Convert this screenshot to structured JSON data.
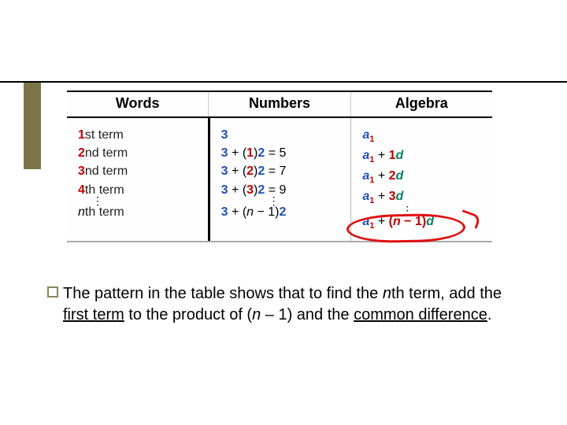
{
  "headers": {
    "c1": "Words",
    "c2": "Numbers",
    "c3": "Algebra"
  },
  "words": {
    "r1_num": "1",
    "r1_suffix": "st term",
    "r2_num": "2",
    "r2_suffix": "nd term",
    "r3_num": "3",
    "r3_suffix": "nd term",
    "r4_num": "4",
    "r4_suffix": "th term",
    "rn_var": "n",
    "rn_suffix": "th term"
  },
  "numbers": {
    "r1": "3",
    "r2_a": "3",
    "r2_b": " + (",
    "r2_c": "1",
    "r2_d": ")",
    "r2_e": "2",
    "r2_f": " = 5",
    "r3_a": "3",
    "r3_b": " + (",
    "r3_c": "2",
    "r3_d": ")",
    "r3_e": "2",
    "r3_f": " = 7",
    "r4_a": "3",
    "r4_b": " + (",
    "r4_c": "3",
    "r4_d": ")",
    "r4_e": "2",
    "r4_f": " = 9",
    "rn_a": "3",
    "rn_b": " + (",
    "rn_c": "n",
    "rn_d": " − 1)",
    "rn_e": "2"
  },
  "algebra": {
    "a": "a",
    "sub": "1",
    "plus": " + ",
    "c2": "1",
    "c3": "2",
    "c4": "3",
    "d": "d",
    "lpar": "(",
    "rpar": ")",
    "n": "n",
    "minus1": " − 1"
  },
  "dots": "⋮",
  "caption": {
    "t1": "The pattern in the table shows that to find the ",
    "t2_n": "n",
    "t2_suffix": "th term, add the ",
    "t3_first": "first term",
    "t4": " to the product of (",
    "t5_n": "n",
    "t6": " – 1) and the ",
    "t7_cd": "common difference",
    "t8": "."
  }
}
